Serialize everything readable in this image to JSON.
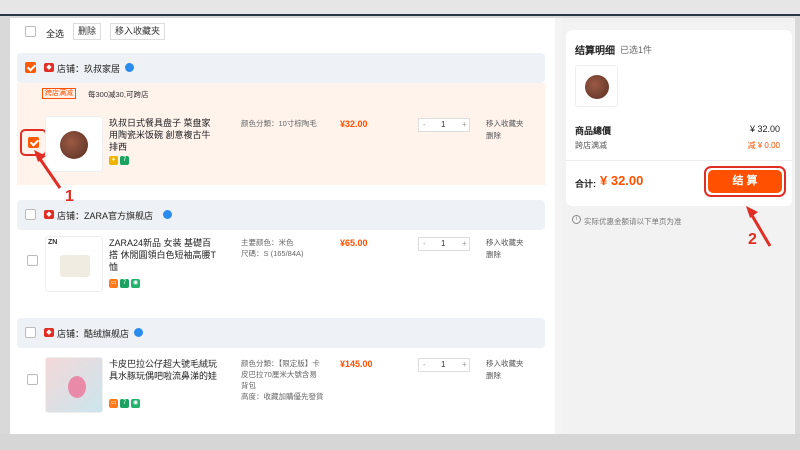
{
  "toolbar": {
    "select_all": "全选",
    "delete": "删除",
    "move_fav": "移入收藏夹"
  },
  "shops": [
    {
      "name": "店铺：玖叔家居",
      "promo_tag": "跨店满减",
      "promo_text": "每300减30,可跨店"
    },
    {
      "name": "店铺：ZARA官方旗舰店"
    },
    {
      "name": "店铺：酷绒旗舰店"
    }
  ],
  "items": [
    {
      "title": "玖叔日式餐具盘子 菜盘家用陶瓷米饭碗 創意複古牛排西",
      "spec_lines": [
        "颜色分類：10寸棕陶毛"
      ],
      "price": "¥32.00",
      "qty": "1",
      "op1": "移入收藏夹",
      "op2": "删除",
      "checked": true
    },
    {
      "title": "ZARA24新品 女装 基礎百搭 休閒圓領白色短袖高腰T恤",
      "spec_lines": [
        "主要颜色：米色",
        "尺碼：S (165/84A)"
      ],
      "price": "¥65.00",
      "qty": "1",
      "op1": "移入收藏夹",
      "op2": "删除",
      "checked": false
    },
    {
      "title": "卡皮巴拉公仔超大號毛絨玩具水豚玩偶吧啦流鼻涕的娃",
      "spec_lines": [
        "颜色分類：【限定版】卡皮巴拉70厘米大號含易",
        "背包",
        "高度：收藏加購優先發貨"
      ],
      "price": "¥145.00",
      "qty": "1",
      "op1": "移入收藏夹",
      "op2": "删除",
      "checked": false
    }
  ],
  "stepper": {
    "minus": "-",
    "plus": "+"
  },
  "summary": {
    "title": "结算明细",
    "selected": "已选1件",
    "total_label": "商品總價",
    "total_value": "¥ 32.00",
    "discount_label": "跨店满减",
    "discount_value": "减 ¥ 0.00",
    "grand_label": "合计:",
    "grand_value": "¥ 32.00",
    "checkout": "结 算",
    "note": "实际优惠金额请以下单页为准"
  },
  "annotations": {
    "a1": "1",
    "a2": "2"
  },
  "colors": {
    "accent": "#ff5000",
    "annotation": "#e02e24",
    "shop_bg": "#eef1f5"
  }
}
